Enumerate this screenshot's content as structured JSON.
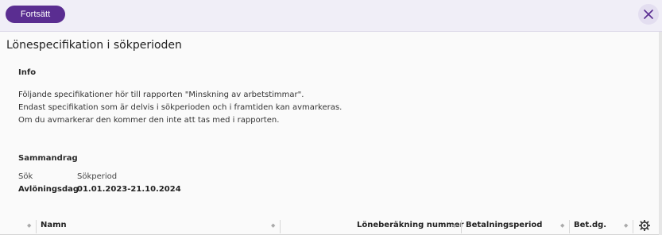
{
  "toolbar": {
    "continue_label": "Fortsätt",
    "close_icon": "close-icon"
  },
  "page": {
    "title": "Lönespecifikation i sökperioden"
  },
  "info": {
    "heading": "Info",
    "lines": [
      "Följande specifikationer hör till rapporten \"Minskning av arbetstimmar\".",
      "Endast specifikation som är delvis i sökperioden och i framtiden kan avmarkeras.",
      "Om du avmarkerar den kommer den inte att tas med i rapporten."
    ]
  },
  "summary": {
    "heading": "Sammandrag",
    "rows": [
      {
        "label": "Sök",
        "value": "Sökperiod"
      },
      {
        "label": "Avlöningsdag",
        "value": "01.01.2023-21.10.2024"
      }
    ]
  },
  "table": {
    "columns": [
      "Namn",
      "Löneberäkning nummer",
      "Betalningsperiod",
      "Bet.dg."
    ],
    "settings_icon": "gear-icon"
  },
  "colors": {
    "accent": "#5a2d91",
    "topbar_bg": "#f0eef7"
  }
}
